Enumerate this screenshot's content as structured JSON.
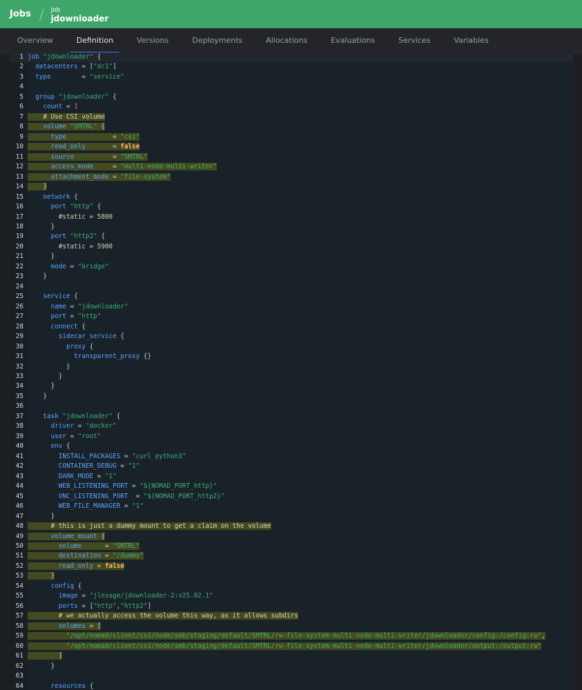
{
  "breadcrumb": {
    "root": "Jobs",
    "type": "Job",
    "name": "jdownloader"
  },
  "tabs": [
    {
      "label": "Overview",
      "active": false
    },
    {
      "label": "Definition",
      "active": true
    },
    {
      "label": "Versions",
      "active": false
    },
    {
      "label": "Deployments",
      "active": false
    },
    {
      "label": "Allocations",
      "active": false
    },
    {
      "label": "Evaluations",
      "active": false
    },
    {
      "label": "Services",
      "active": false
    },
    {
      "label": "Variables",
      "active": false
    }
  ],
  "colors": {
    "topbar": "#3fa66a",
    "tab_indicator": "#3a78f2",
    "editor_bg": "#192129",
    "keyword": "#58a6ff",
    "string": "#3cb273",
    "number": "#f07178",
    "boolean": "#ffb86c",
    "highlight": "#d4d200"
  },
  "code_lines": [
    "job \"jdownloader\" {",
    "  datacenters = [\"dc1\"]",
    "  type        = \"service\"",
    "",
    "  group \"jdownloader\" {",
    "    count = 1",
    "    # Use CSI volume",
    "    volume \"SMTRL\" {",
    "      type            = \"csi\"",
    "      read_only       = false",
    "      source          = \"SMTRL\"",
    "      access_mode     = \"multi-node-multi-writer\"",
    "      attachment_mode = \"file-system\"",
    "    }",
    "    network {",
    "      port \"http\" {",
    "        #static = 5800",
    "      }",
    "      port \"http2\" {",
    "        #static = 5900",
    "      }",
    "      mode = \"bridge\"",
    "    }",
    "",
    "    service {",
    "      name = \"jdownloader\"",
    "      port = \"http\"",
    "      connect {",
    "        sidecar_service {",
    "          proxy {",
    "            transparent_proxy {}",
    "          }",
    "        }",
    "      }",
    "    }",
    "",
    "    task \"jdownloader\" {",
    "      driver = \"docker\"",
    "      user = \"root\"",
    "      env {",
    "        INSTALL_PACKAGES = \"curl python3\"",
    "        CONTAINER_DEBUG = \"1\"",
    "        DARK_MODE = \"1\"",
    "        WEB_LISTENING_PORT = \"${NOMAD_PORT_http}\"",
    "        VNC_LISTENING_PORT  = \"${NOMAD_PORT_http2}\"",
    "        WEB_FILE_MANAGER = \"1\"",
    "      }",
    "      # this is just a dummy mount to get a claim on the volume",
    "      volume_mount {",
    "        volume      = \"SMTRL\"",
    "        destination = \"/dummy\"",
    "        read_only = false",
    "      }",
    "      config {",
    "        image = \"jlesage/jdownloader-2:v25.02.1\"",
    "        ports = [\"http\",\"http2\"]",
    "        # we actually access the volume this way, as it allows subdirs",
    "        volumes = [",
    "          \"/opt/nomad/client/csi/node/smb/staging/default/SMTRL/rw-file-system-multi-node-multi-writer/jdownloader/config:/config:rw\",",
    "          \"/opt/nomad/client/csi/node/smb/staging/default/SMTRL/rw-file-system-multi-node-multi-writer/jdownloader/output:/output:rw\"",
    "        ]",
    "      }",
    "",
    "      resources {"
  ],
  "highlighted_lines": [
    7,
    8,
    9,
    10,
    11,
    12,
    13,
    14,
    48,
    49,
    50,
    51,
    52,
    53,
    57,
    58,
    59,
    60,
    61
  ],
  "active_line": 1
}
